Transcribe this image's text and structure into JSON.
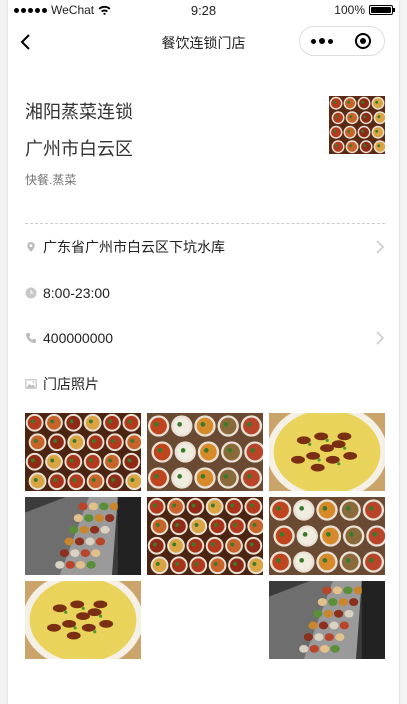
{
  "status_bar": {
    "carrier": "WeChat",
    "time": "9:28",
    "battery": "100%"
  },
  "nav": {
    "title": "餐饮连锁门店"
  },
  "store": {
    "name": "湘阳蒸菜连锁",
    "area": "广州市白云区",
    "category": "快餐.蒸菜",
    "address": "广东省广州市白云区下坑水库",
    "hours": "8:00-23:00",
    "phone": "400000000",
    "photos_label": "门店照片"
  },
  "icons": {
    "back": "chevron-left-icon",
    "more": "more-dots-icon",
    "close": "close-circle-icon",
    "location": "location-pin-icon",
    "clock": "clock-icon",
    "phone": "phone-icon",
    "image": "image-icon",
    "chevron": "chevron-right-icon"
  },
  "photos": [
    {
      "kind": "bowls-red"
    },
    {
      "kind": "bowls-mixed"
    },
    {
      "kind": "egg-dish"
    },
    {
      "kind": "counter"
    },
    {
      "kind": "bowls-red"
    },
    {
      "kind": "bowls-mixed"
    },
    {
      "kind": "egg-dish"
    },
    {
      "kind": "empty"
    },
    {
      "kind": "counter"
    }
  ],
  "colors": {
    "text": "#222222",
    "muted": "#777777",
    "divider": "#cccccc"
  }
}
